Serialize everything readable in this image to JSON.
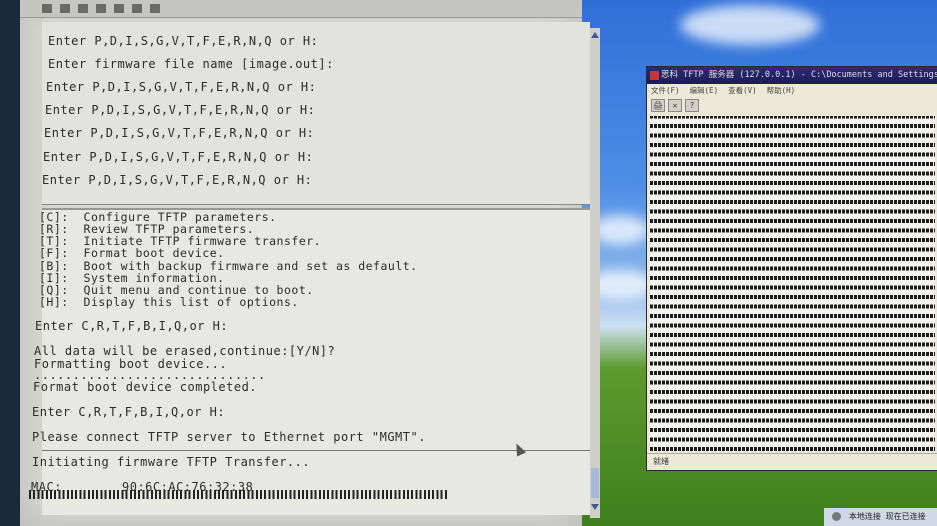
{
  "terminal": {
    "upper_lines": [
      "Enter P,D,I,S,G,V,T,F,E,R,N,Q or H:",
      "Enter firmware file name [image.out]:",
      "Enter P,D,I,S,G,V,T,F,E,R,N,Q or H:",
      "Enter P,D,I,S,G,V,T,F,E,R,N,Q or H:",
      "Enter P,D,I,S,G,V,T,F,E,R,N,Q or H:",
      "Enter P,D,I,S,G,V,T,F,E,R,N,Q or H:",
      "Enter P,D,I,S,G,V,T,F,E,R,N,Q or H:"
    ],
    "options": [
      "[C]:  Configure TFTP parameters.",
      "[R]:  Review TFTP parameters.",
      "[T]:  Initiate TFTP firmware transfer.",
      "[F]:  Format boot device.",
      "[B]:  Boot with backup firmware and set as default.",
      "[I]:  System information.",
      "[Q]:  Quit menu and continue to boot.",
      "[H]:  Display this list of options."
    ],
    "prompt1": "Enter C,R,T,F,B,I,Q,or H:",
    "erase_warning": "All data will be erased,continue:[Y/N]?",
    "formatting": "Formatting boot device...",
    "dots": "..............................",
    "format_done": "Format boot device completed.",
    "prompt2": "Enter C,R,T,F,B,I,Q,or H:",
    "connect_msg": "Please connect TFTP server to Ethernet port \"MGMT\".",
    "initiating": "Initiating firmware TFTP Transfer...",
    "mac_label": "MAC:",
    "mac_value": "90:6C:AC:76:32:38"
  },
  "tftp_window": {
    "title": "思科 TFTP 服务器 (127.0.0.1) - C:\\Documents and Settings\\",
    "menu": [
      "文件(F)",
      "编辑(E)",
      "查看(V)",
      "帮助(H)"
    ],
    "tools": [
      "🖨",
      "✕",
      "?"
    ],
    "status": "就绪"
  },
  "taskbar": {
    "network_status": "本地连接  现在已连接"
  }
}
